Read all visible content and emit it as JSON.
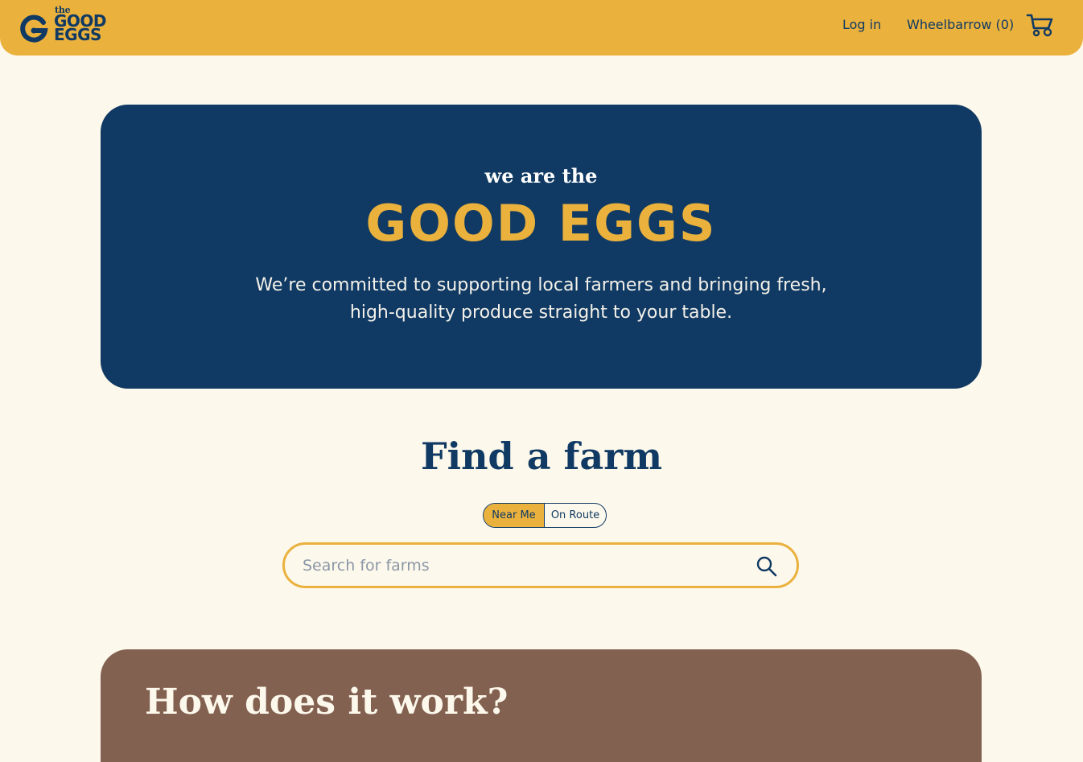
{
  "header": {
    "logo": {
      "the": "the",
      "line1": "GOOD",
      "line2": "EGGS",
      "icon": "swirl-g-icon"
    },
    "login_label": "Log in",
    "wheelbarrow_label": "Wheelbarrow (0)",
    "cart_icon": "wheelbarrow-cart-icon"
  },
  "hero": {
    "kicker": "we are the",
    "brand": "GOOD EGGS",
    "description": "We’re committed to supporting local farmers and bringing fresh, high-quality produce straight to your table."
  },
  "find": {
    "title": "Find a farm",
    "toggle": {
      "near_label": "Near Me",
      "route_label": "On Route",
      "selected": "Near Me"
    },
    "search": {
      "placeholder": "Search for farms",
      "value": "",
      "icon": "search-icon"
    }
  },
  "how": {
    "title": "How does it work?"
  },
  "colors": {
    "mustard": "#eab13d",
    "navy": "#103a63",
    "cream": "#fdf8ec",
    "brown": "#826150"
  }
}
